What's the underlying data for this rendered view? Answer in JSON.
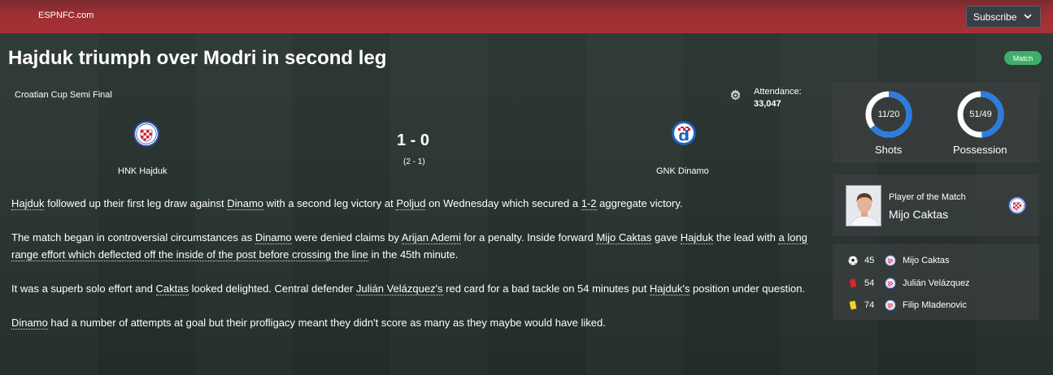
{
  "header": {
    "brand": "ESPNFC.com",
    "subscribe_label": "Subscribe"
  },
  "article": {
    "headline": "Hajduk triumph over Modri in second leg",
    "badge": "Match",
    "paragraphs": [
      [
        "",
        "Hajduk",
        " followed up their first leg draw against ",
        "Dinamo",
        " with a second leg victory at ",
        "Poljud",
        " on Wednesday which secured a ",
        "1-2",
        " aggregate victory."
      ],
      [
        "The match began in controversial circumstances as ",
        "Dinamo",
        " were denied claims by ",
        "Arijan Ademi",
        " for a penalty. Inside forward ",
        "Mijo Caktas",
        " gave ",
        "Hajduk",
        " the lead with ",
        "a long range effort which deflected off the inside of the post before crossing the line",
        " in the 45th minute."
      ],
      [
        "It was a superb solo effort and ",
        "Caktas",
        " looked delighted. Central defender ",
        "Julián Velázquez's",
        " red card for a bad tackle on 54 minutes put ",
        "Hajduk's",
        " position under question."
      ],
      [
        "",
        "Dinamo",
        " had a number of attempts at goal but their profligacy meant they didn't score as many as they maybe would have liked."
      ]
    ]
  },
  "match": {
    "competition": "Croatian Cup Semi Final",
    "attendance_label": "Attendance:",
    "attendance_value": "33,047",
    "home_team": "HNK Hajduk",
    "away_team": "GNK Dinamo",
    "score": "1 - 0",
    "aggregate": "(2 - 1)"
  },
  "stats": {
    "shots": {
      "label": "Shots",
      "value": "11/20",
      "home": 11,
      "away": 20
    },
    "possession": {
      "label": "Possession",
      "value": "51/49",
      "home": 51,
      "away": 49
    }
  },
  "player_of_match": {
    "label": "Player of the Match",
    "name": "Mijo Caktas"
  },
  "events": [
    {
      "icon": "goal-ball-icon",
      "minute": "45",
      "player": "Mijo Caktas"
    },
    {
      "icon": "red-card-icon",
      "minute": "54",
      "player": "Julián Velázquez"
    },
    {
      "icon": "yellow-card-icon",
      "minute": "74",
      "player": "Filip Mladenovic"
    }
  ],
  "colors": {
    "topbar": "#a83236",
    "badge_green": "#3fae6a",
    "donut_blue": "#2a7de1",
    "hajduk_blue": "#2b4d9c",
    "hajduk_red": "#d71f2e",
    "dinamo_blue": "#1f5fbf"
  }
}
